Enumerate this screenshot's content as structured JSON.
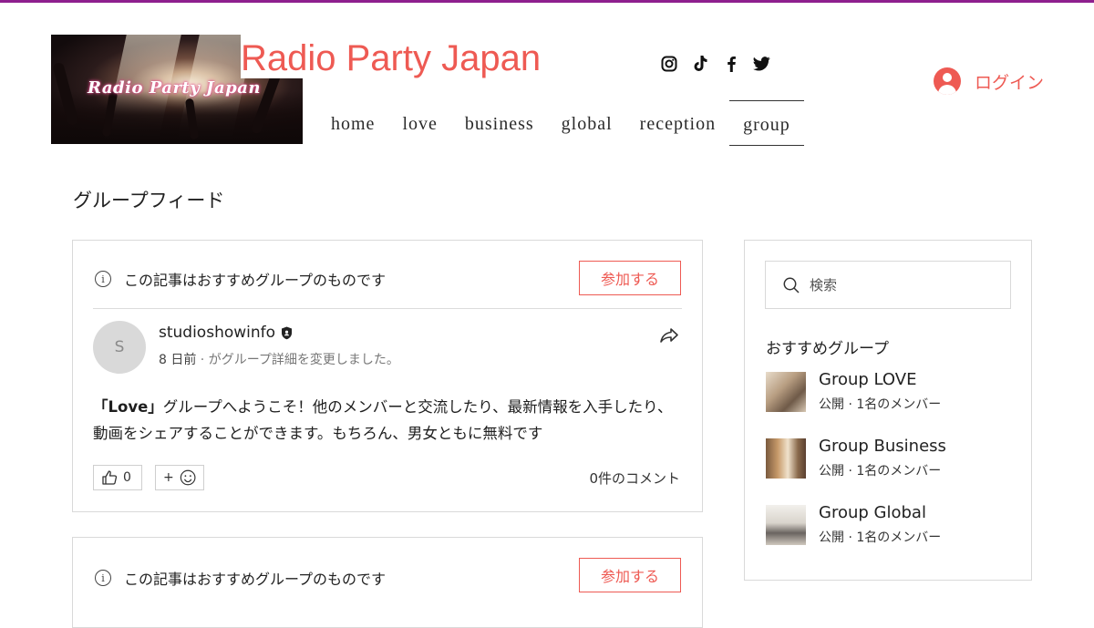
{
  "site": {
    "title": "Radio Party Japan",
    "banner_text": "Radio Party Japan",
    "login_label": "ログイン",
    "accent_color": "#ee5a53"
  },
  "social": [
    "instagram-icon",
    "tiktok-icon",
    "facebook-icon",
    "twitter-icon"
  ],
  "nav": {
    "items": [
      {
        "label": "home"
      },
      {
        "label": "love"
      },
      {
        "label": "business"
      },
      {
        "label": "global"
      },
      {
        "label": "reception"
      },
      {
        "label": "group"
      }
    ],
    "active": "group"
  },
  "page": {
    "title": "グループフィード"
  },
  "posts": [
    {
      "promo_text": "この記事はおすすめグループのものです",
      "join_label": "参加する",
      "avatar_initial": "S",
      "author": "studioshowinfo",
      "time": "8 日前",
      "action": " · がグループ詳細を変更しました。",
      "body_bold": "「Love」",
      "body_text": "グループへようこそ！他のメンバーと交流したり、最新情報を入手したり、動画をシェアすることができます。もちろん、男女ともに無料です",
      "likes": "0",
      "add_reaction": "+",
      "comments": "0件のコメント"
    },
    {
      "promo_text": "この記事はおすすめグループのものです",
      "join_label": "参加する"
    }
  ],
  "sidebar": {
    "search_placeholder": "検索",
    "heading": "おすすめグループ",
    "groups": [
      {
        "name": "Group LOVE",
        "meta": "公開 · 1名のメンバー"
      },
      {
        "name": "Group Business",
        "meta": "公開 · 1名のメンバー"
      },
      {
        "name": "Group Global",
        "meta": "公開 · 1名のメンバー"
      }
    ]
  }
}
